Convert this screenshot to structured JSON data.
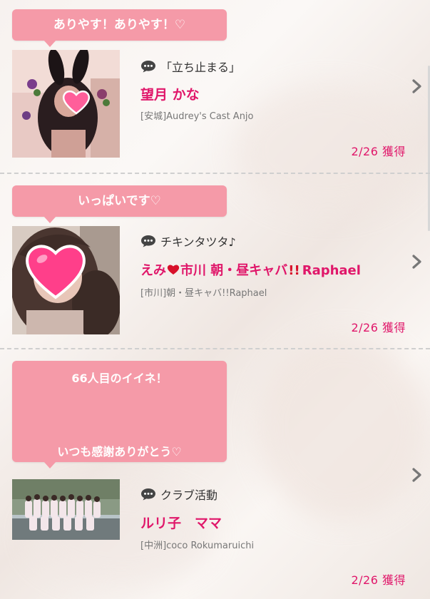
{
  "items": [
    {
      "bubble": "ありやす！ありやす！♡",
      "comment": "「立ち止まる」",
      "name": "望月 かな",
      "shop": "[安城]Audrey's Cast Anjo",
      "date": "2/26 獲得"
    },
    {
      "bubble": "いっぱいです♡",
      "comment": "チキンタツタ♪",
      "name_part1": "えみ",
      "name_part2": "市川 朝・昼キャバ",
      "name_part3": "Raphael",
      "shop": "[市川]朝・昼キャバ!!Raphael",
      "date": "2/26 獲得"
    },
    {
      "bubble_line1": "66人目のイイネ！",
      "bubble_line2": "いつも感謝ありがとう♡",
      "comment": "クラブ活動",
      "name": "ルリ子　ママ",
      "shop": "[中洲]coco Rokumaruichi",
      "date": "2/26 獲得"
    }
  ],
  "colors": {
    "bubble": "#f59aa8",
    "accent": "#e0176a",
    "muted": "#777777"
  }
}
